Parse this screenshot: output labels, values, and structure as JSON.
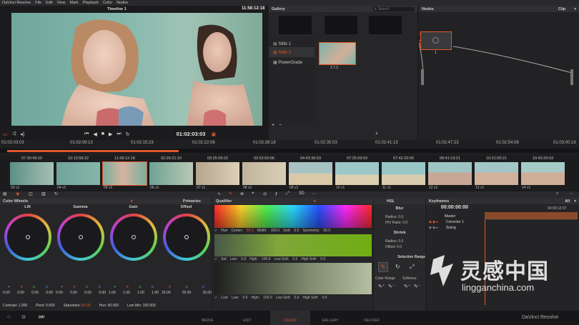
{
  "menu": [
    "DaVinci Resolve",
    "File",
    "Edit",
    "View",
    "Mark",
    "Playback",
    "Color",
    "Nodes"
  ],
  "viewer": {
    "title": "Timeline 1",
    "timecode_top": "11:58:12:18",
    "timecode": "01:02:03:03"
  },
  "gallery": {
    "title": "Gallery",
    "search_placeholder": "Search",
    "albums": [
      "Stills 1",
      "Stills 2",
      "PowerGrade"
    ],
    "still_label": "1.7.1",
    "add": "+",
    "remove": "−"
  },
  "nodes": {
    "title": "Nodes",
    "mode": "Clip",
    "node_label": "1"
  },
  "ruler": [
    "01:02:03:03",
    "01:02:09:13",
    "01:02:15:23",
    "01:02:22:08",
    "01:02:28:18",
    "01:02:35:03",
    "01:02:41:13",
    "01:02:47:23",
    "01:02:54:08",
    "01:03:00:18"
  ],
  "clips": [
    {
      "tc": "07:30:49:10",
      "label": "03  v1"
    },
    {
      "tc": "10:13:58:22",
      "label": "04  v1"
    },
    {
      "tc": "11:58:12:18",
      "label": "05  v1"
    },
    {
      "tc": "02:29:21:10",
      "label": "06  v1"
    },
    {
      "tc": "03:25:09:22",
      "label": "07  v1"
    },
    {
      "tc": "02:52:50:06",
      "label": "08  v1"
    },
    {
      "tc": "04:43:36:03",
      "label": "09  v1"
    },
    {
      "tc": "07:25:59:03",
      "label": "10  v1"
    },
    {
      "tc": "07:42:20:00",
      "label": "11  v1"
    },
    {
      "tc": "09:41:19:21",
      "label": "12  v1"
    },
    {
      "tc": "10:21:00:21",
      "label": "13  v1"
    },
    {
      "tc": "10:43:20:03",
      "label": "14  v1"
    }
  ],
  "color_wheels": {
    "title": "Color Wheels",
    "mode": "Primaries",
    "wheels": [
      {
        "name": "Lift",
        "vals": [
          "0.00",
          "0.00",
          "0.00",
          "0.00"
        ]
      },
      {
        "name": "Gamma",
        "vals": [
          "0.00",
          "0.00",
          "0.00",
          "0.00"
        ]
      },
      {
        "name": "Gain",
        "vals": [
          "1.00",
          "1.00",
          "1.00",
          "1.00"
        ]
      },
      {
        "name": "Offset",
        "vals": [
          "25.00",
          "25.00",
          "25.00",
          ""
        ]
      }
    ],
    "channels": [
      "Y",
      "R",
      "G",
      "B"
    ],
    "bottom": {
      "contrast": "Contrast: 1.000",
      "pivot": "Pivot: 0.500",
      "saturation_label": "Saturation:",
      "saturation_value": "50.00",
      "hue": "Hue: 50.000",
      "lum_mix": "Lum Mix: 100.000"
    }
  },
  "qualifier": {
    "title": "Qualifier",
    "hue": {
      "label": "Hue",
      "center_label": "Center:",
      "center": "50.0",
      "width_label": "Width:",
      "width": "100.0",
      "soft_label": "Soft:",
      "soft": "0.0",
      "symmetry_label": "Symmetry:",
      "symmetry": "50.0"
    },
    "sat": {
      "label": "Sat",
      "low_label": "Low:",
      "low": "0.0",
      "high_label": "High:",
      "high": "100.0",
      "lowsoft_label": "Low Soft:",
      "lowsoft": "0.0",
      "highsoft_label": "High Soft:",
      "highsoft": "0.0"
    },
    "lum": {
      "label": "Lum",
      "low_label": "Low:",
      "low": "0.0",
      "high_label": "High:",
      "high": "100.0",
      "lowsoft_label": "Low Soft:",
      "lowsoft": "0.0",
      "highsoft_label": "High Soft:",
      "highsoft": "0.0"
    }
  },
  "hsl": {
    "title": "HSL",
    "blur": "Blur",
    "radius_label": "Radius:",
    "radius": "0.0",
    "hv_label": "H/V Ratio:",
    "hv": "0.0",
    "shrink": "Shrink",
    "radius2": "0.0",
    "offset_label": "Offset:",
    "offset": "0.0",
    "selection_range": "Selection Range",
    "color_range": "Color Range",
    "softness": "Softness"
  },
  "keyframes": {
    "title": "Keyframes",
    "filter": "All",
    "timecode": "00:00:00:00",
    "end": "00:00:12:07",
    "tracks": [
      "Master",
      "Corrector 1",
      "Sizing"
    ]
  },
  "footer": {
    "tabs": [
      "MEDIA",
      "EDIT",
      "COLOR",
      "GALLERY",
      "DELIVER"
    ],
    "project": "jqb",
    "app": "DaVinci Resolve"
  },
  "watermark": {
    "brand": "灵感中国",
    "url": "lingganchina.com"
  },
  "colors": {
    "accent": "#e0572b",
    "panel": "#262628",
    "background": "#1d1d1f"
  }
}
